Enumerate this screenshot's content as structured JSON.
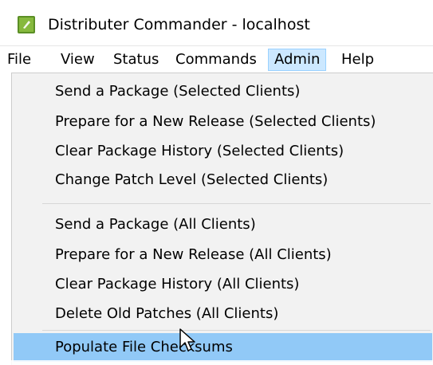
{
  "window": {
    "title": "Distributer Commander - localhost",
    "icon": "app-icon"
  },
  "menubar": {
    "items": [
      {
        "label": "File"
      },
      {
        "label": "View"
      },
      {
        "label": "Status"
      },
      {
        "label": "Commands"
      },
      {
        "label": "Admin",
        "active": true
      },
      {
        "label": "Help"
      }
    ]
  },
  "admin_menu": {
    "group_selected": [
      {
        "label": "Send a Package (Selected Clients)"
      },
      {
        "label": "Prepare for a New Release (Selected Clients)"
      },
      {
        "label": "Clear Package History (Selected Clients)"
      },
      {
        "label": "Change Patch Level (Selected Clients)"
      }
    ],
    "group_all": [
      {
        "label": "Send a Package  (All Clients)"
      },
      {
        "label": "Prepare for a New Release (All Clients)"
      },
      {
        "label": "Clear Package History (All Clients)"
      },
      {
        "label": "Delete Old Patches (All Clients)"
      }
    ],
    "group_other": [
      {
        "label": "Populate File Checksums",
        "highlighted": true
      }
    ]
  },
  "colors": {
    "menu_active_bg": "#cce8ff",
    "menu_active_border": "#99d1ff",
    "item_highlight": "#91c9f7",
    "dropdown_bg": "#f2f2f2",
    "app_icon": "#86b93e"
  }
}
